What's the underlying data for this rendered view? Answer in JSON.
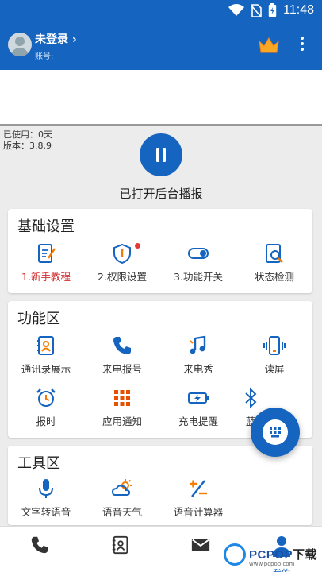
{
  "status_bar": {
    "time": "11:48"
  },
  "header": {
    "login_text": "未登录 ›",
    "account_label": "账号:"
  },
  "info": {
    "used_days": "已使用：0天",
    "version": "版本：3.8.9"
  },
  "playback": {
    "status_label": "已打开后台播报"
  },
  "basic_settings": {
    "title": "基础设置",
    "items": [
      {
        "label": "1.新手教程",
        "icon": "tutorial-icon",
        "highlight": true
      },
      {
        "label": "2.权限设置",
        "icon": "permission-shield-icon"
      },
      {
        "label": "3.功能开关",
        "icon": "toggle-icon"
      },
      {
        "label": "状态检测",
        "icon": "status-check-icon"
      }
    ]
  },
  "function_area": {
    "title": "功能区",
    "items": [
      {
        "label": "通讯录展示",
        "icon": "contacts-icon"
      },
      {
        "label": "来电报号",
        "icon": "phone-icon"
      },
      {
        "label": "来电秀",
        "icon": "music-note-icon"
      },
      {
        "label": "读屏",
        "icon": "screen-vibrate-icon"
      },
      {
        "label": "报时",
        "icon": "alarm-clock-icon"
      },
      {
        "label": "应用通知",
        "icon": "apps-grid-icon"
      },
      {
        "label": "充电提醒",
        "icon": "battery-charging-icon"
      },
      {
        "label": "蓝",
        "icon": "bluetooth-icon"
      }
    ]
  },
  "tools_area": {
    "title": "工具区",
    "items": [
      {
        "label": "文字转语音",
        "icon": "microphone-icon"
      },
      {
        "label": "语音天气",
        "icon": "weather-icon"
      },
      {
        "label": "语音计算器",
        "icon": "calculator-icon"
      }
    ]
  },
  "bottom_nav": {
    "items": [
      {
        "icon": "phone-icon"
      },
      {
        "icon": "contacts-icon"
      },
      {
        "icon": "message-icon"
      },
      {
        "icon": "person-icon",
        "label": "我的",
        "active": true
      }
    ]
  },
  "watermark": {
    "brand": "PCPOP",
    "suffix": "下载",
    "sub": "www.pcpop.com"
  },
  "colors": {
    "primary": "#1565c0",
    "accent_red": "#d32f2f",
    "icon_orange": "#f57c00"
  }
}
